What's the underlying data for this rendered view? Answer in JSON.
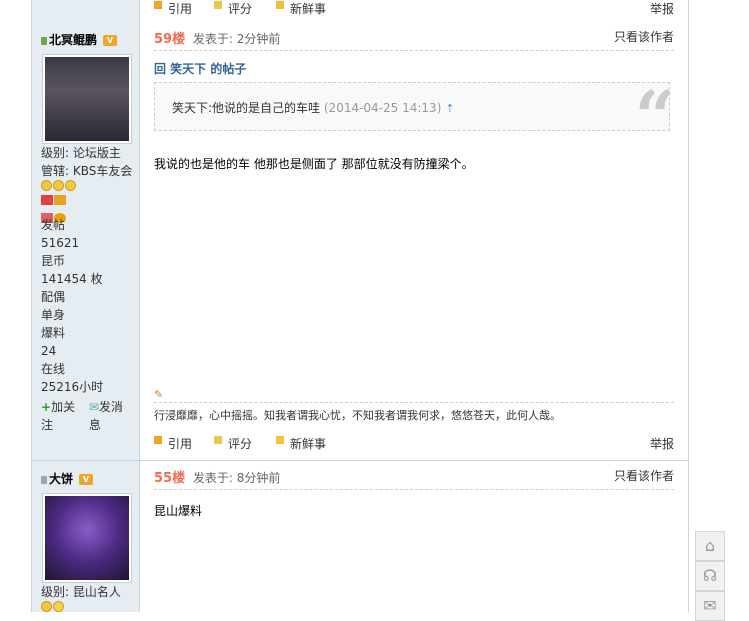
{
  "posts": [
    {
      "user": {
        "name": "北冥鲲鹏",
        "level": "级别: 论坛版主",
        "manage": "管辖: KBS车友会",
        "posts_label": "发帖",
        "posts_value": "51621",
        "coins_label": "昆币",
        "coins_value": "141454 枚",
        "spouse_label": "配偶",
        "spouse_value": "单身",
        "baoliao_label": "爆料",
        "baoliao_value": "24",
        "online_label": "在线",
        "online_value": "25216小时",
        "follow": "加关注",
        "message": "发消息"
      },
      "floor": "59楼",
      "posted": "发表于: 2分钟前",
      "only_author": "只看该作者",
      "reply_link": "回 笑天下 的帖子",
      "quote_text": "笑天下:他说的是自己的车哇",
      "quote_time": "(2014-04-25 14:13)",
      "body": "我说的也是他的车 他那也是侧面了 那部位就没有防撞梁个。",
      "signature": "行浸靡靡，心中摇摇。知我者谓我心忧，不知我者谓我何求，悠悠苍天，此何人哉。",
      "toolbar": {
        "quote": "引用",
        "rate": "评分",
        "news": "新鲜事",
        "report": "举报"
      }
    },
    {
      "user": {
        "name": "大饼",
        "level": "级别: 昆山名人"
      },
      "floor": "55楼",
      "posted": "发表于: 8分钟前",
      "only_author": "只看该作者",
      "body": "昆山爆料"
    }
  ],
  "top_toolbar": {
    "quote": "引用",
    "rate": "评分",
    "news": "新鲜事",
    "report": "举报"
  },
  "side_buttons": [
    "back-to-top",
    "customer-service",
    "wechat"
  ]
}
